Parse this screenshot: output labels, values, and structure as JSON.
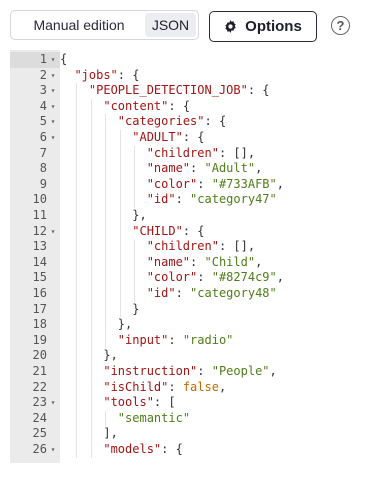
{
  "toolbar": {
    "manual_label": "Manual edition",
    "json_label": "JSON",
    "options_label": "Options",
    "help_glyph": "?"
  },
  "editor": {
    "lines": [
      {
        "n": "1",
        "fold": true,
        "indent": 0,
        "tokens": [
          {
            "t": "p",
            "v": "{"
          }
        ]
      },
      {
        "n": "2",
        "fold": true,
        "indent": 1,
        "tokens": [
          {
            "t": "k",
            "v": "\"jobs\""
          },
          {
            "t": "p",
            "v": ": {"
          }
        ]
      },
      {
        "n": "3",
        "fold": true,
        "indent": 2,
        "tokens": [
          {
            "t": "k",
            "v": "\"PEOPLE_DETECTION_JOB\""
          },
          {
            "t": "p",
            "v": ": {"
          }
        ]
      },
      {
        "n": "4",
        "fold": true,
        "indent": 3,
        "tokens": [
          {
            "t": "k",
            "v": "\"content\""
          },
          {
            "t": "p",
            "v": ": {"
          }
        ]
      },
      {
        "n": "5",
        "fold": true,
        "indent": 4,
        "tokens": [
          {
            "t": "k",
            "v": "\"categories\""
          },
          {
            "t": "p",
            "v": ": {"
          }
        ]
      },
      {
        "n": "6",
        "fold": true,
        "indent": 5,
        "tokens": [
          {
            "t": "k",
            "v": "\"ADULT\""
          },
          {
            "t": "p",
            "v": ": {"
          }
        ]
      },
      {
        "n": "7",
        "fold": false,
        "indent": 6,
        "tokens": [
          {
            "t": "k",
            "v": "\"children\""
          },
          {
            "t": "p",
            "v": ": [],"
          }
        ]
      },
      {
        "n": "8",
        "fold": false,
        "indent": 6,
        "tokens": [
          {
            "t": "k",
            "v": "\"name\""
          },
          {
            "t": "p",
            "v": ": "
          },
          {
            "t": "s",
            "v": "\"Adult\""
          },
          {
            "t": "p",
            "v": ","
          }
        ]
      },
      {
        "n": "9",
        "fold": false,
        "indent": 6,
        "tokens": [
          {
            "t": "k",
            "v": "\"color\""
          },
          {
            "t": "p",
            "v": ": "
          },
          {
            "t": "s",
            "v": "\"#733AFB\""
          },
          {
            "t": "p",
            "v": ","
          }
        ]
      },
      {
        "n": "10",
        "fold": false,
        "indent": 6,
        "tokens": [
          {
            "t": "k",
            "v": "\"id\""
          },
          {
            "t": "p",
            "v": ": "
          },
          {
            "t": "s",
            "v": "\"category47\""
          }
        ]
      },
      {
        "n": "11",
        "fold": false,
        "indent": 5,
        "tokens": [
          {
            "t": "p",
            "v": "},"
          }
        ]
      },
      {
        "n": "12",
        "fold": true,
        "indent": 5,
        "tokens": [
          {
            "t": "k",
            "v": "\"CHILD\""
          },
          {
            "t": "p",
            "v": ": {"
          }
        ]
      },
      {
        "n": "13",
        "fold": false,
        "indent": 6,
        "tokens": [
          {
            "t": "k",
            "v": "\"children\""
          },
          {
            "t": "p",
            "v": ": [],"
          }
        ]
      },
      {
        "n": "14",
        "fold": false,
        "indent": 6,
        "tokens": [
          {
            "t": "k",
            "v": "\"name\""
          },
          {
            "t": "p",
            "v": ": "
          },
          {
            "t": "s",
            "v": "\"Child\""
          },
          {
            "t": "p",
            "v": ","
          }
        ]
      },
      {
        "n": "15",
        "fold": false,
        "indent": 6,
        "tokens": [
          {
            "t": "k",
            "v": "\"color\""
          },
          {
            "t": "p",
            "v": ": "
          },
          {
            "t": "s",
            "v": "\"#8274c9\""
          },
          {
            "t": "p",
            "v": ","
          }
        ]
      },
      {
        "n": "16",
        "fold": false,
        "indent": 6,
        "tokens": [
          {
            "t": "k",
            "v": "\"id\""
          },
          {
            "t": "p",
            "v": ": "
          },
          {
            "t": "s",
            "v": "\"category48\""
          }
        ]
      },
      {
        "n": "17",
        "fold": false,
        "indent": 5,
        "tokens": [
          {
            "t": "p",
            "v": "}"
          }
        ]
      },
      {
        "n": "18",
        "fold": false,
        "indent": 4,
        "tokens": [
          {
            "t": "p",
            "v": "},"
          }
        ]
      },
      {
        "n": "19",
        "fold": false,
        "indent": 4,
        "tokens": [
          {
            "t": "k",
            "v": "\"input\""
          },
          {
            "t": "p",
            "v": ": "
          },
          {
            "t": "s",
            "v": "\"radio\""
          }
        ]
      },
      {
        "n": "20",
        "fold": false,
        "indent": 3,
        "tokens": [
          {
            "t": "p",
            "v": "},"
          }
        ]
      },
      {
        "n": "21",
        "fold": false,
        "indent": 3,
        "tokens": [
          {
            "t": "k",
            "v": "\"instruction\""
          },
          {
            "t": "p",
            "v": ": "
          },
          {
            "t": "s",
            "v": "\"People\""
          },
          {
            "t": "p",
            "v": ","
          }
        ]
      },
      {
        "n": "22",
        "fold": false,
        "indent": 3,
        "tokens": [
          {
            "t": "k",
            "v": "\"isChild\""
          },
          {
            "t": "p",
            "v": ": "
          },
          {
            "t": "b",
            "v": "false"
          },
          {
            "t": "p",
            "v": ","
          }
        ]
      },
      {
        "n": "23",
        "fold": true,
        "indent": 3,
        "tokens": [
          {
            "t": "k",
            "v": "\"tools\""
          },
          {
            "t": "p",
            "v": ": ["
          }
        ]
      },
      {
        "n": "24",
        "fold": false,
        "indent": 4,
        "tokens": [
          {
            "t": "s",
            "v": "\"semantic\""
          }
        ]
      },
      {
        "n": "25",
        "fold": false,
        "indent": 3,
        "tokens": [
          {
            "t": "p",
            "v": "],"
          }
        ]
      },
      {
        "n": "26",
        "fold": true,
        "indent": 3,
        "tokens": [
          {
            "t": "k",
            "v": "\"models\""
          },
          {
            "t": "p",
            "v": ": {"
          }
        ]
      }
    ]
  },
  "colors": {
    "key": "#a31515",
    "string": "#4f7d1a",
    "boolean": "#c26a00",
    "gutter": "#ebebeb"
  }
}
